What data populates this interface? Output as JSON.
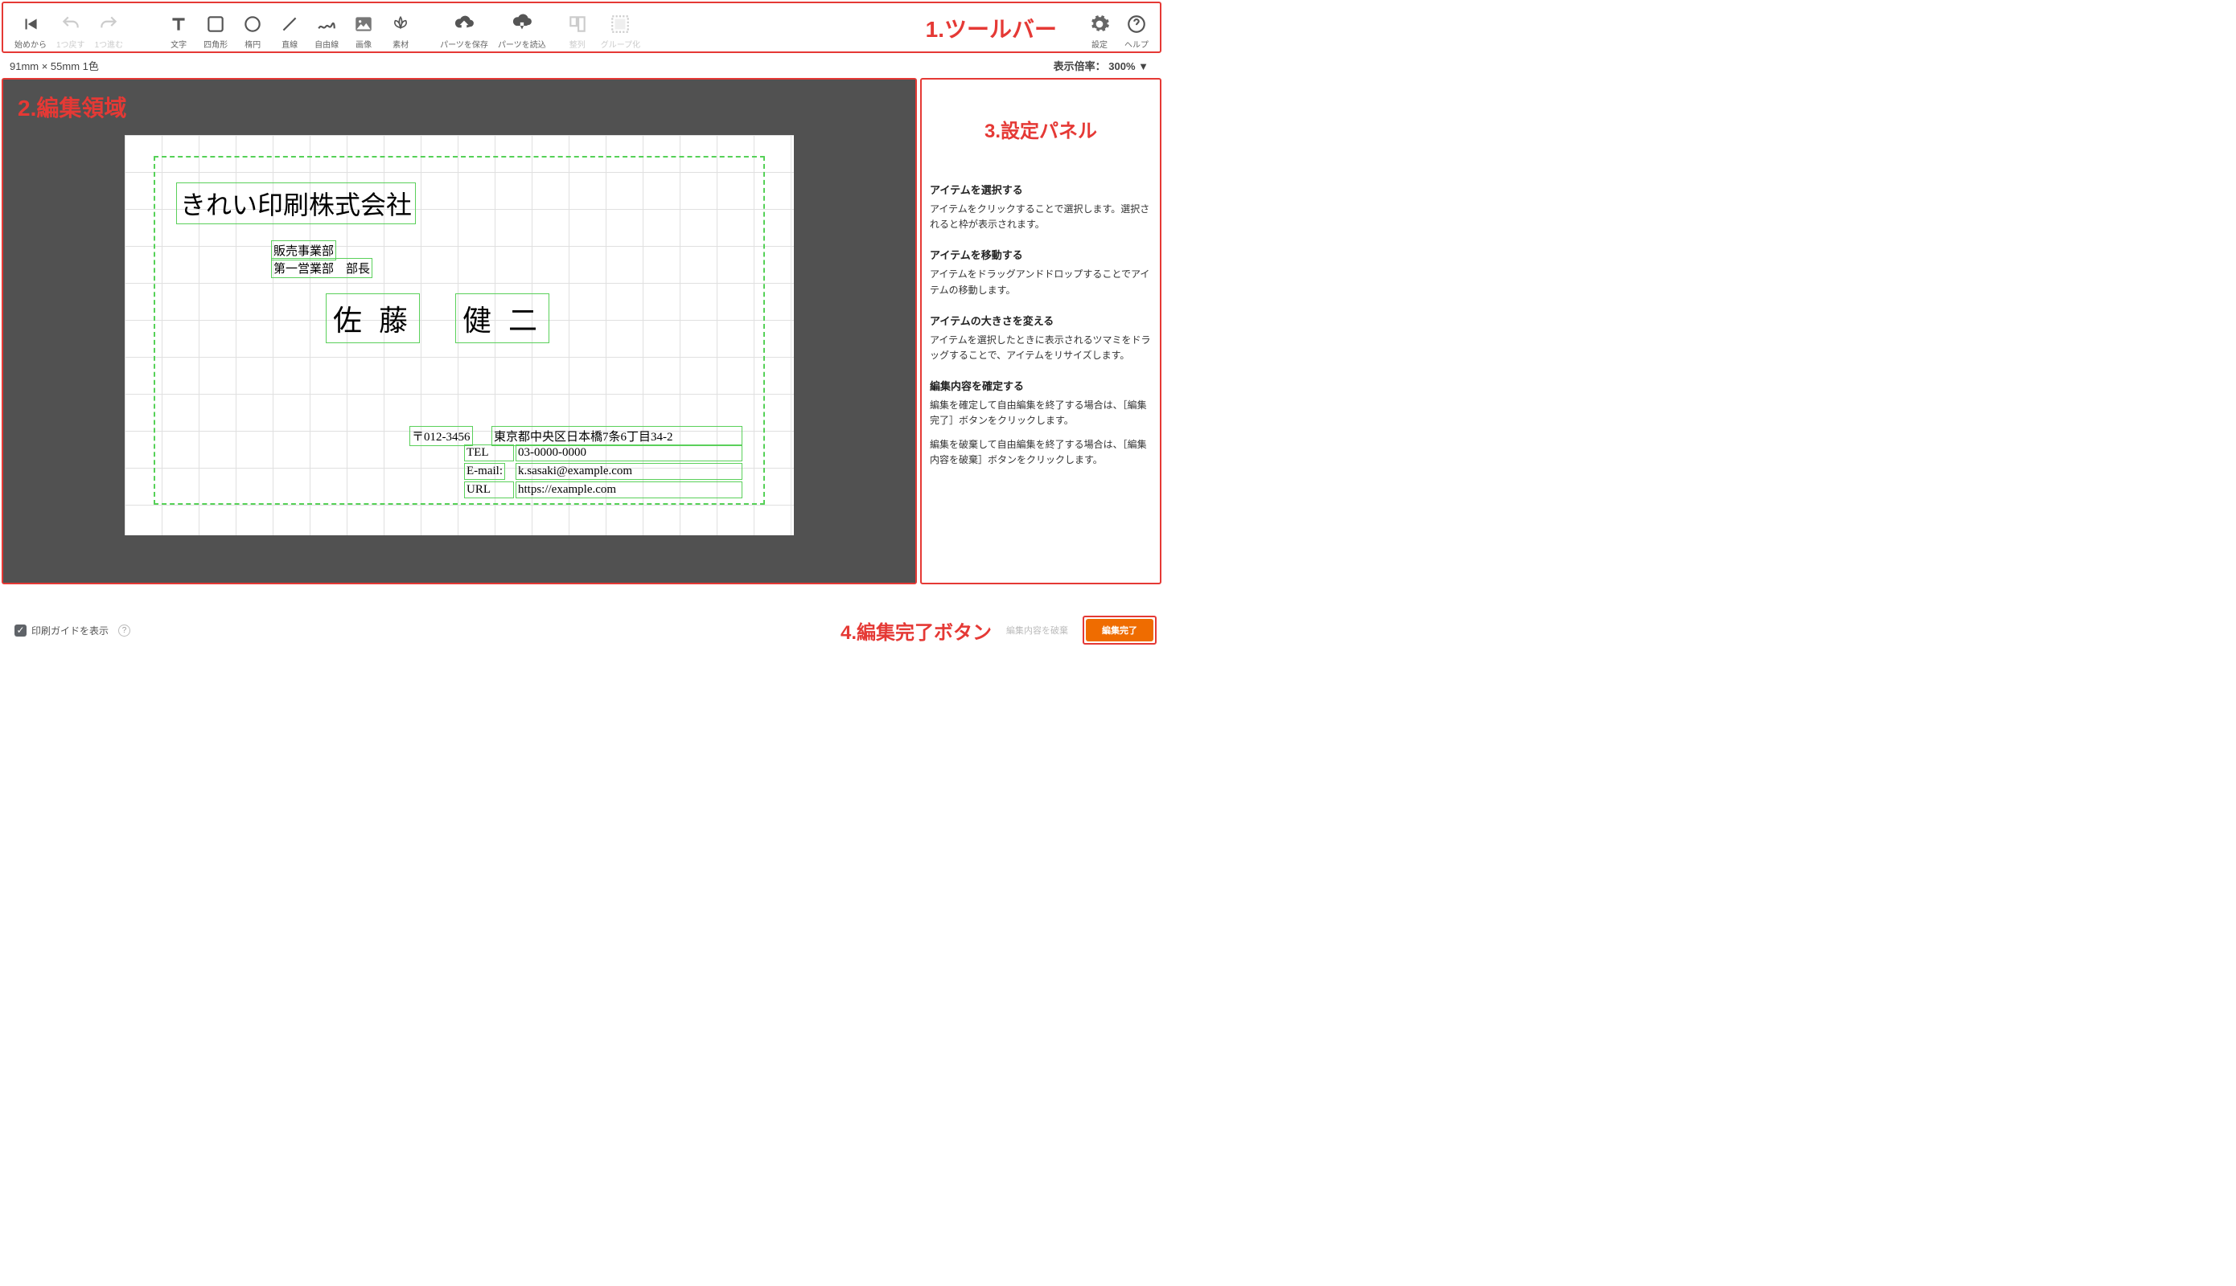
{
  "annotations": {
    "toolbar": "1.ツールバー",
    "edit": "2.編集領域",
    "panel": "3.設定パネル",
    "done": "4.編集完了ボタン"
  },
  "toolbar": {
    "from_start": "始めから",
    "undo": "1つ戻す",
    "redo": "1つ進む",
    "text": "文字",
    "rect": "四角形",
    "ellipse": "楕円",
    "line": "直線",
    "free": "自由線",
    "image": "画像",
    "material": "素材",
    "save_part": "パーツを保存",
    "load_part": "パーツを読込",
    "align": "整列",
    "group": "グループ化",
    "settings": "設定",
    "help": "ヘルプ"
  },
  "status": {
    "size": "91mm × 55mm  1色",
    "zoom_label": "表示倍率：",
    "zoom_value": "300% ▼"
  },
  "card": {
    "company": "きれい印刷株式会社",
    "dept1": "販売事業部",
    "dept2": "第一営業部　部長",
    "name1": "佐 藤",
    "name2": "健 二",
    "postal_lbl": "〒012-3456",
    "postal_val": "東京都中央区日本橋7条6丁目34-2",
    "tel_lbl": "TEL",
    "tel_val": "03-0000-0000",
    "email_lbl": "E-mail:",
    "email_val": "k.sasaki@example.com",
    "url_lbl": "URL",
    "url_val": "https://example.com"
  },
  "panel": {
    "h1": "アイテムを選択する",
    "p1": "アイテムをクリックすることで選択します。選択されると枠が表示されます。",
    "h2": "アイテムを移動する",
    "p2": "アイテムをドラッグアンドドロップすることでアイテムの移動します。",
    "h3": "アイテムの大きさを変える",
    "p3": "アイテムを選択したときに表示されるツマミをドラッグすることで、アイテムをリサイズします。",
    "h4": "編集内容を確定する",
    "p4a": "編集を確定して自由編集を終了する場合は、［編集完了］ボタンをクリックします。",
    "p4b": "編集を破棄して自由編集を終了する場合は、［編集内容を破棄］ボタンをクリックします。"
  },
  "footer": {
    "guide": "印刷ガイドを表示",
    "discard": "編集内容を破棄",
    "done": "編集完了"
  }
}
